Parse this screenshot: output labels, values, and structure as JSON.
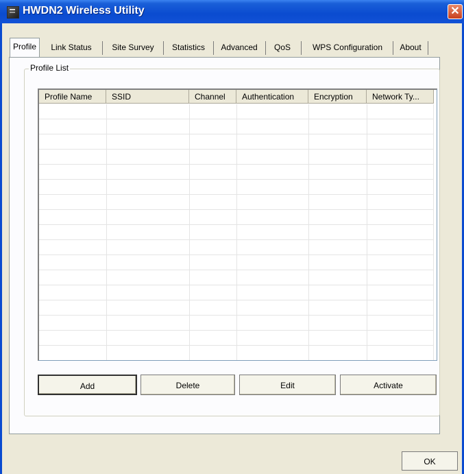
{
  "window": {
    "title": "HWDN2 Wireless Utility",
    "close_glyph": "✕"
  },
  "tabs": [
    {
      "label": "Profile"
    },
    {
      "label": "Link Status"
    },
    {
      "label": "Site Survey"
    },
    {
      "label": "Statistics"
    },
    {
      "label": "Advanced"
    },
    {
      "label": "QoS"
    },
    {
      "label": "WPS Configuration"
    },
    {
      "label": "About"
    }
  ],
  "profile_list": {
    "group_label": "Profile List",
    "columns": [
      "Profile Name",
      "SSID",
      "Channel",
      "Authentication",
      "Encryption",
      "Network Ty..."
    ]
  },
  "buttons": {
    "add": "Add",
    "delete": "Delete",
    "edit": "Edit",
    "activate": "Activate",
    "ok": "OK"
  },
  "icons": {
    "app": "app-icon",
    "close": "close-icon"
  }
}
